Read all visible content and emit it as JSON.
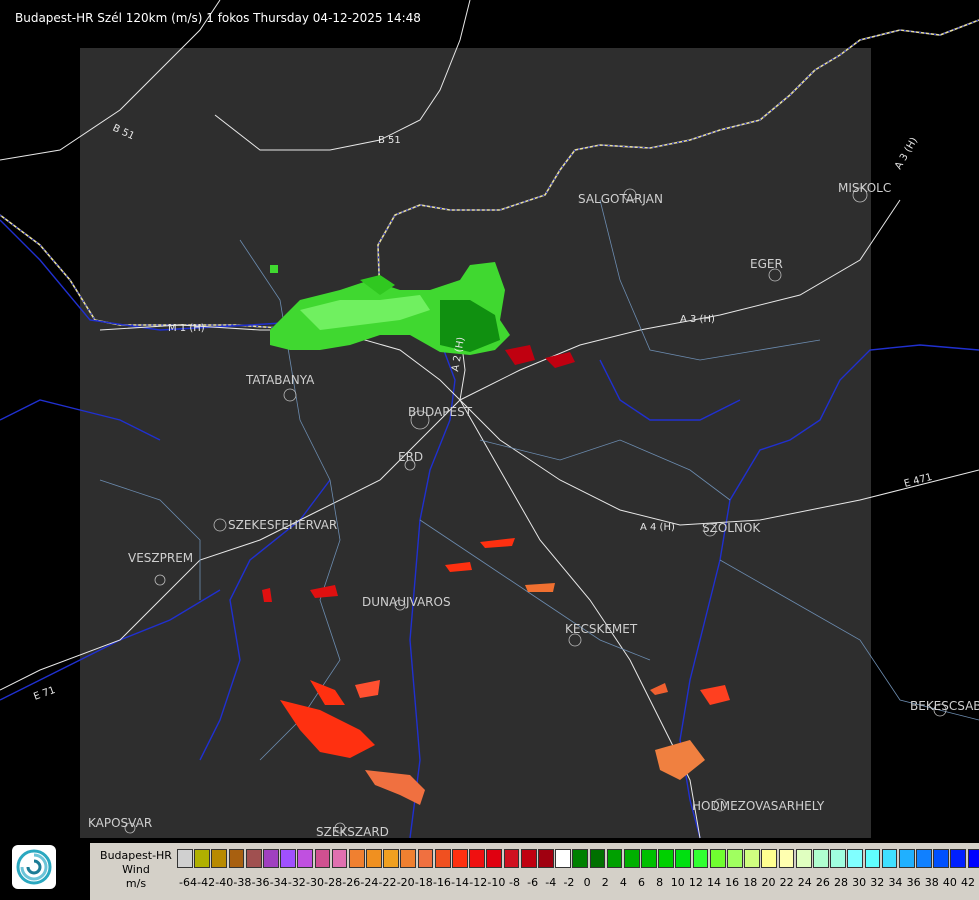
{
  "header": {
    "title": "Budapest-HR Szél 120km (m/s) 1 fokos Thursday 04-12-2025 14:48"
  },
  "map": {
    "places": [
      "SALGOTARJAN",
      "MISKOLC",
      "EGER",
      "TATABANYA",
      "BUDAPEST",
      "ERD",
      "SZEKESFEHERVAR",
      "VESZPREM",
      "DUNAUJVAROS",
      "KECSKEMET",
      "SZOLNOK",
      "BEKESCSABA",
      "HODMEZOVASARHELY",
      "KAPOSVAR",
      "SZEKSZARD"
    ],
    "roads": [
      "B 51",
      "B 51",
      "A 3 (H)",
      "A 3 (H)",
      "M 1 (H)",
      "A 4 (H)",
      "E 471",
      "E 71",
      "A 2 (H)"
    ]
  },
  "legend": {
    "line1": "Budapest-HR",
    "line2": "Wind",
    "line3": "m/s",
    "colors": [
      "#d0d0d0",
      "#b0b000",
      "#b88a00",
      "#a86010",
      "#a05050",
      "#a040c0",
      "#a050ff",
      "#c050e0",
      "#d05090",
      "#e070b0",
      "#f08030",
      "#f09020",
      "#f0a020",
      "#f08030",
      "#f07040",
      "#f05020",
      "#ff3010",
      "#f01010",
      "#e00010",
      "#d01020",
      "#c00010",
      "#a00010",
      "#ffffff",
      "#008000",
      "#007000",
      "#00a000",
      "#00b000",
      "#00c000",
      "#00d000",
      "#00e010",
      "#30ff30",
      "#70ff30",
      "#a0ff60",
      "#d0ff80",
      "#ffff90",
      "#ffffb0",
      "#e0ffc0",
      "#b0ffd0",
      "#a0ffe0",
      "#80ffff",
      "#60ffff",
      "#40e0ff",
      "#20b0ff",
      "#1080ff",
      "#0050ff",
      "#0020ff",
      "#0000ff"
    ],
    "ticks": [
      "-64",
      "-42",
      "-40",
      "-38",
      "-36",
      "-34",
      "-32",
      "-30",
      "-28",
      "-26",
      "-24",
      "-22",
      "-20",
      "-18",
      "-16",
      "-14",
      "-12",
      "-10",
      "-8",
      "-6",
      "-4",
      "-2",
      "0",
      "2",
      "4",
      "6",
      "8",
      "10",
      "12",
      "14",
      "16",
      "18",
      "20",
      "22",
      "24",
      "26",
      "28",
      "30",
      "32",
      "34",
      "36",
      "38",
      "40",
      "42"
    ]
  }
}
